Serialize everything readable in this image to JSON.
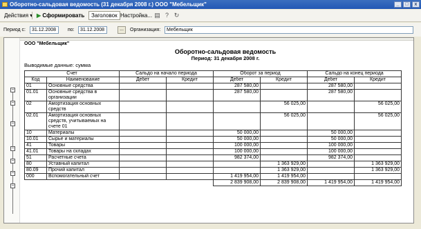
{
  "window": {
    "title": "Оборотно-сальдовая ведомость (31 декабря 2008 г.) ООО \"Мебельщик\"",
    "minimize": "_",
    "maximize": "□",
    "close": "x"
  },
  "toolbar": {
    "actions": "Действия ▾",
    "generate": "Сформировать",
    "header": "Заголовок",
    "settings": "Настройка...",
    "generate_icon": "play-icon",
    "help_icon": "help-icon",
    "refresh_icon": "refresh-icon",
    "copy_icon": "copy-icon"
  },
  "filters": {
    "period_from_label": "Период с:",
    "period_from": "31.12.2008",
    "period_to_label": "по:",
    "period_to": "31.12.2008",
    "select_button": "...",
    "org_label": "Организация:",
    "org_value": "Мебельщик"
  },
  "report": {
    "org": "ООО \"Мебельщик\"",
    "title": "Оборотно-сальдовая ведомость",
    "period": "Период: 31 декабря 2008 г.",
    "output": "Выводимые данные: сумма",
    "headers": {
      "account": "Счет",
      "code": "Код",
      "name": "Наименование",
      "opening": "Сальдо на начало периода",
      "turnover": "Оборот за период",
      "closing": "Сальдо на конец периода",
      "debit": "Дебет",
      "credit": "Кредит"
    },
    "rows": [
      {
        "code": "01",
        "name": "Основные средства",
        "od": "",
        "oc": "",
        "td": "287 580,00",
        "tc": "",
        "cd": "287 580,00",
        "cc": ""
      },
      {
        "code": "01.01",
        "name": "Основные средства в организации",
        "od": "",
        "oc": "",
        "td": "287 580,00",
        "tc": "",
        "cd": "287 580,00",
        "cc": ""
      },
      {
        "code": "02",
        "name": "Амортизация основных средств",
        "od": "",
        "oc": "",
        "td": "",
        "tc": "56 025,00",
        "cd": "",
        "cc": "56 025,00"
      },
      {
        "code": "02.01",
        "name": "Амортизация основных средств, учитываемых на счете 01",
        "od": "",
        "oc": "",
        "td": "",
        "tc": "56 025,00",
        "cd": "",
        "cc": "56 025,00"
      },
      {
        "code": "10",
        "name": "Материалы",
        "od": "",
        "oc": "",
        "td": "50 000,00",
        "tc": "",
        "cd": "50 000,00",
        "cc": ""
      },
      {
        "code": "10.01",
        "name": "Сырье и материалы",
        "od": "",
        "oc": "",
        "td": "50 000,00",
        "tc": "",
        "cd": "50 000,00",
        "cc": ""
      },
      {
        "code": "41",
        "name": "Товары",
        "od": "",
        "oc": "",
        "td": "100 000,00",
        "tc": "",
        "cd": "100 000,00",
        "cc": ""
      },
      {
        "code": "41.01",
        "name": "Товары на складах",
        "od": "",
        "oc": "",
        "td": "100 000,00",
        "tc": "",
        "cd": "100 000,00",
        "cc": ""
      },
      {
        "code": "51",
        "name": "Расчетные счета",
        "od": "",
        "oc": "",
        "td": "982 374,00",
        "tc": "",
        "cd": "982 374,00",
        "cc": ""
      },
      {
        "code": "80",
        "name": "Уставный капитал",
        "od": "",
        "oc": "",
        "td": "",
        "tc": "1 363 929,00",
        "cd": "",
        "cc": "1 363 929,00"
      },
      {
        "code": "80.09",
        "name": "Прочий капитал",
        "od": "",
        "oc": "",
        "td": "",
        "tc": "1 363 929,00",
        "cd": "",
        "cc": "1 363 929,00"
      },
      {
        "code": "000",
        "name": "Вспомогательный счет",
        "od": "",
        "oc": "",
        "td": "1 419 954,00",
        "tc": "1 419 954,00",
        "cd": "",
        "cc": ""
      }
    ],
    "totals": {
      "td": "2 839 908,00",
      "tc": "2 839 908,00",
      "cd": "1 419 954,00",
      "cc": "1 419 954,00"
    }
  }
}
